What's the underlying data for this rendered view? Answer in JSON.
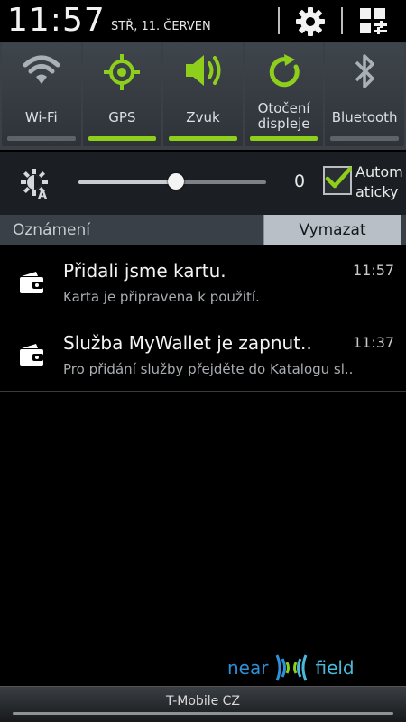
{
  "status": {
    "time": "11:57",
    "date": "STŘ, 11. ČERVEN"
  },
  "header": {
    "settings_icon": "gear-icon",
    "toggles_icon": "grid-toggles-icon"
  },
  "toggles": [
    {
      "label": "Wi-Fi",
      "icon": "wifi-icon",
      "on": false
    },
    {
      "label": "GPS",
      "icon": "gps-icon",
      "on": true
    },
    {
      "label": "Zvuk",
      "icon": "sound-icon",
      "on": true
    },
    {
      "label": "Otočení displeje",
      "icon": "rotation-icon",
      "on": true
    },
    {
      "label": "Bluetooth",
      "icon": "bluetooth-icon",
      "on": false
    }
  ],
  "brightness": {
    "value_label": "0",
    "level": 0.52,
    "auto_label": "Automaticky",
    "auto_checked": true
  },
  "notifications_header": {
    "title": "Oznámení",
    "clear_label": "Vymazat"
  },
  "notifications": [
    {
      "title": "Přidali jsme kartu.",
      "time": "11:57",
      "text": "Karta je připravena k použití.",
      "icon": "wallet-icon"
    },
    {
      "title": "Služba MyWallet je zapnut..",
      "time": "11:37",
      "text": "Pro přidání služby přejděte do Katalogu sl..",
      "icon": "wallet-icon"
    }
  ],
  "footer": {
    "logo_left": "near",
    "logo_right": "field",
    "carrier": "T-Mobile CZ"
  },
  "colors": {
    "accent_green": "#8ecf1c",
    "background": "#000000",
    "panel": "#3a4046"
  }
}
